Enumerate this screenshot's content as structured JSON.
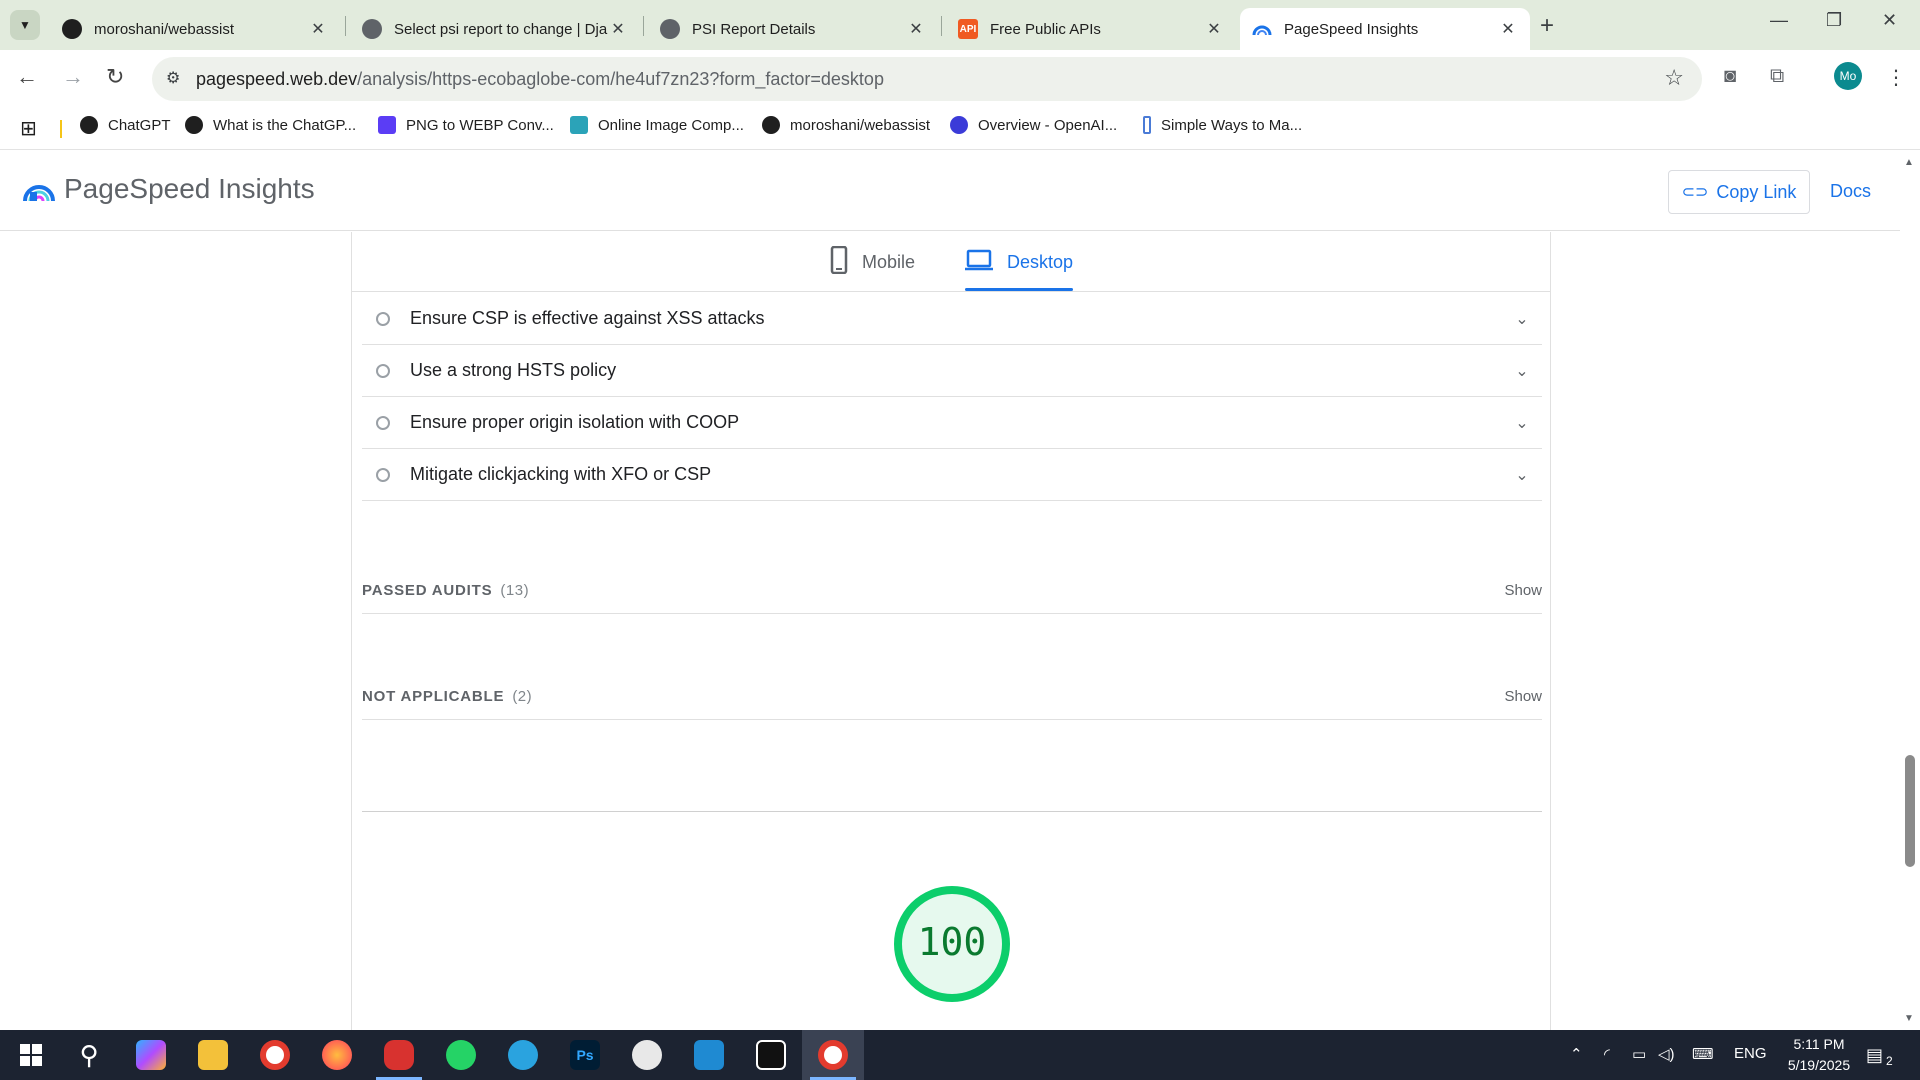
{
  "browser": {
    "tabs": [
      {
        "title": "moroshani/webassist",
        "favicon": "github-icon",
        "active": false
      },
      {
        "title": "Select psi report to change | Dja",
        "favicon": "globe-icon",
        "active": false
      },
      {
        "title": "PSI Report Details",
        "favicon": "globe-icon",
        "active": false
      },
      {
        "title": "Free Public APIs",
        "favicon": "api-icon",
        "active": false
      },
      {
        "title": "PageSpeed Insights",
        "favicon": "pagespeed-icon",
        "active": true
      }
    ],
    "url_host": "pagespeed.web.dev",
    "url_path": "/analysis/https-ecobaglobe-com/he4uf7zn23?form_factor=desktop",
    "profile_initials": "Mo",
    "bookmarks": [
      {
        "label": "ChatGPT",
        "icon": "openai-icon"
      },
      {
        "label": "What is the ChatGP...",
        "icon": "openai-icon"
      },
      {
        "label": "PNG to WEBP Conv...",
        "icon": "convert-icon"
      },
      {
        "label": "Online Image Comp...",
        "icon": "image-icon"
      },
      {
        "label": "moroshani/webassist",
        "icon": "github-icon"
      },
      {
        "label": "Overview - OpenAI...",
        "icon": "openai-icon"
      },
      {
        "label": "Simple Ways to Ma...",
        "icon": "bookmark-icon"
      }
    ]
  },
  "header": {
    "title": "PageSpeed Insights",
    "copy_link": "Copy Link",
    "docs": "Docs"
  },
  "device_tabs": {
    "mobile": "Mobile",
    "desktop": "Desktop",
    "selected": "desktop"
  },
  "audits": [
    "Ensure CSP is effective against XSS attacks",
    "Use a strong HSTS policy",
    "Ensure proper origin isolation with COOP",
    "Mitigate clickjacking with XFO or CSP"
  ],
  "groups": {
    "passed": {
      "label": "PASSED AUDITS",
      "count": "(13)",
      "action": "Show"
    },
    "not_applicable": {
      "label": "NOT APPLICABLE",
      "count": "(2)",
      "action": "Show"
    }
  },
  "score": {
    "value": "100",
    "color": "#0cce6b"
  },
  "colors": {
    "accent": "#1a73e8",
    "pass": "#0cce6b"
  },
  "taskbar": {
    "time": "5:11 PM",
    "date": "5/19/2025",
    "language": "ENG",
    "notifications": "2"
  }
}
